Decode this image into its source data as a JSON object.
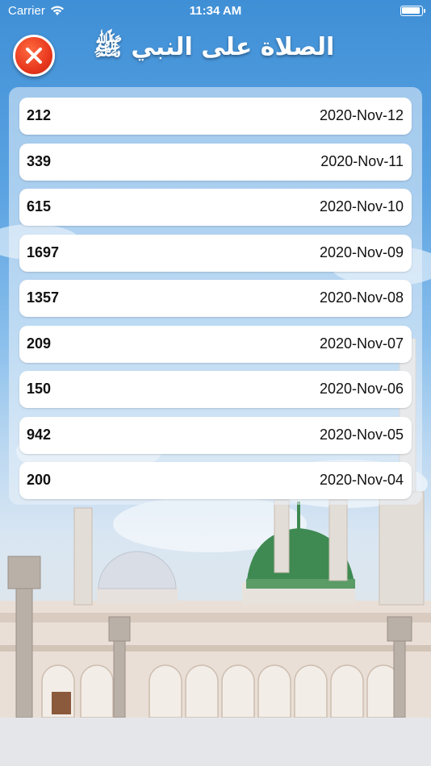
{
  "status_bar": {
    "carrier": "Carrier",
    "time": "11:34 AM"
  },
  "header": {
    "title": "الصلاة على النبي ﷺ",
    "close_icon": "close-icon",
    "accent_color": "#e8381e"
  },
  "entries": [
    {
      "count": "212",
      "date": "2020-Nov-12"
    },
    {
      "count": "339",
      "date": "2020-Nov-11"
    },
    {
      "count": "615",
      "date": "2020-Nov-10"
    },
    {
      "count": "1697",
      "date": "2020-Nov-09"
    },
    {
      "count": "1357",
      "date": "2020-Nov-08"
    },
    {
      "count": "209",
      "date": "2020-Nov-07"
    },
    {
      "count": "150",
      "date": "2020-Nov-06"
    },
    {
      "count": "942",
      "date": "2020-Nov-05"
    },
    {
      "count": "200",
      "date": "2020-Nov-04"
    }
  ]
}
